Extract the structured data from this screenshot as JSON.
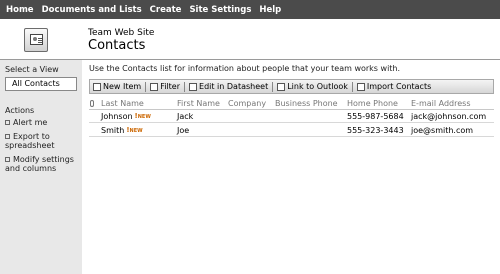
{
  "topnav": {
    "items": [
      "Home",
      "Documents and Lists",
      "Create",
      "Site Settings",
      "Help"
    ]
  },
  "header": {
    "site_name": "Team Web Site",
    "page_title": "Contacts"
  },
  "sidebar": {
    "select_view_label": "Select a View",
    "current_view": "All Contacts",
    "actions_label": "Actions",
    "actions": [
      "Alert me",
      "Export to spreadsheet",
      "Modify settings and columns"
    ]
  },
  "main": {
    "description": "Use the Contacts list for information about people that your team works with.",
    "toolbar": {
      "new_item": "New Item",
      "filter": "Filter",
      "edit_datasheet": "Edit in Datasheet",
      "link_outlook": "Link to Outlook",
      "import_contacts": "Import Contacts"
    },
    "columns": [
      "Last Name",
      "First Name",
      "Company",
      "Business Phone",
      "Home Phone",
      "E-mail Address"
    ],
    "new_badge": "NEW",
    "rows": [
      {
        "last_name": "Johnson",
        "first_name": "Jack",
        "company": "",
        "business_phone": "",
        "home_phone": "555-987-5684",
        "email": "jack@johnson.com"
      },
      {
        "last_name": "Smith",
        "first_name": "Joe",
        "company": "",
        "business_phone": "",
        "home_phone": "555-323-3443",
        "email": "joe@smith.com"
      }
    ]
  }
}
